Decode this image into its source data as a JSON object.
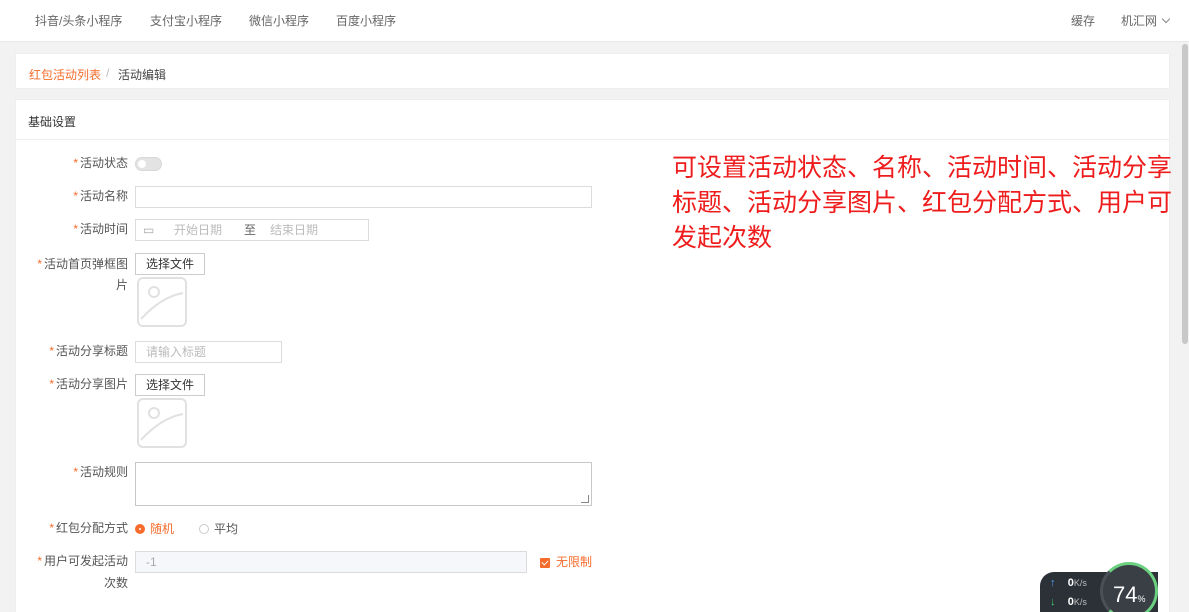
{
  "topnav": {
    "items": [
      "抖音/头条小程序",
      "支付宝小程序",
      "微信小程序",
      "百度小程序"
    ],
    "cache": "缓存",
    "user": "机汇网"
  },
  "breadcrumb": {
    "parent": "红包活动列表",
    "separator": "/",
    "current": "活动编辑"
  },
  "section": {
    "title": "基础设置"
  },
  "form": {
    "status_label": "活动状态",
    "name_label": "活动名称",
    "time_label": "活动时间",
    "time_start_placeholder": "开始日期",
    "time_sep": "至",
    "time_end_placeholder": "结束日期",
    "popup_label_line1": "活动首页弹框图",
    "popup_label_line2": "片",
    "choose_file": "选择文件",
    "share_title_label": "活动分享标题",
    "share_title_placeholder": "请输入标题",
    "share_image_label": "活动分享图片",
    "rules_label": "活动规则",
    "distribution_label": "红包分配方式",
    "distribution_options": [
      "随机",
      "平均"
    ],
    "count_label_line1": "用户可发起活动",
    "count_label_line2": "次数",
    "count_value": "-1",
    "unlimited_label": "无限制"
  },
  "annotation": {
    "text": "可设置活动状态、名称、活动时间、活动分享标题、活动分享图片、红包分配方式、用户可发起次数"
  },
  "net_widget": {
    "up_value": "0",
    "down_value": "0",
    "unit": "K/s",
    "percent": "74",
    "percent_unit": "%"
  },
  "colors": {
    "accent": "#f56c2c",
    "annotation": "#ee1c1c"
  }
}
